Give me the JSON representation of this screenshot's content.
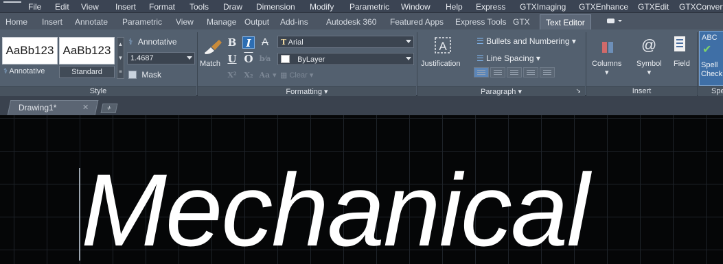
{
  "menu": [
    "File",
    "Edit",
    "View",
    "Insert",
    "Format",
    "Tools",
    "Draw",
    "Dimension",
    "Modify",
    "Parametric",
    "Window",
    "Help",
    "Express",
    "GTXImaging",
    "GTXEnhance",
    "GTXEdit",
    "GTXConvert"
  ],
  "tabs": [
    "Home",
    "Insert",
    "Annotate",
    "Parametric",
    "View",
    "Manage",
    "Output",
    "Add-ins",
    "Autodesk 360",
    "Featured Apps",
    "Express Tools",
    "GTX",
    "Text Editor"
  ],
  "style_panel": {
    "swatch_1": "AaBb123",
    "swatch_2": "AaBb123",
    "swatch_1_label": "Annotative",
    "swatch_2_label": "Standard",
    "annotative_toggle": "Annotative",
    "text_height": "1.4687",
    "mask": "Mask",
    "title": "Style"
  },
  "formatting_panel": {
    "match": "Match",
    "bold": "B",
    "italic": "I",
    "strike": "A",
    "underline": "U",
    "overline": "O",
    "font": "Arial",
    "color": "ByLayer",
    "clear": "Clear",
    "case": "Aa",
    "title": "Formatting"
  },
  "paragraph_panel": {
    "justification": "Justification",
    "bullets": "Bullets and Numbering",
    "line_spacing": "Line Spacing",
    "title": "Paragraph"
  },
  "insert_panel": {
    "columns": "Columns",
    "symbol": "Symbol",
    "field": "Field",
    "title": "Insert"
  },
  "spell_panel": {
    "spell_line1": "Spell",
    "spell_line2": "Check",
    "icon_text": "ABC",
    "title": "Spe"
  },
  "document": {
    "tab_name": "Drawing1*",
    "text": "Mechanical"
  },
  "colors": {
    "ribbon": "#53606f",
    "active_tab": "#5d6878",
    "highlight": "#2d6eb3",
    "canvas": "#050607"
  }
}
